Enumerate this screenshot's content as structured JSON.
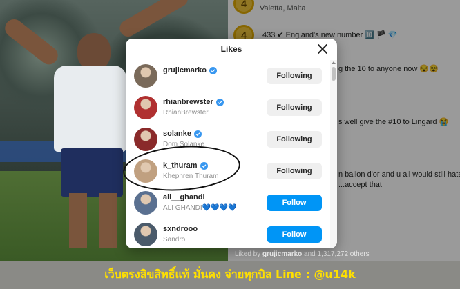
{
  "modal": {
    "title": "Likes",
    "close_label": "✕",
    "items": [
      {
        "username": "grujicmarko",
        "fullname": "",
        "verified": true,
        "button": "Following",
        "following": true,
        "avatar_color": "#7a6a5a"
      },
      {
        "username": "rhianbrewster",
        "fullname": "RhianBrewster",
        "verified": true,
        "button": "Following",
        "following": true,
        "avatar_color": "#b03030"
      },
      {
        "username": "solanke",
        "fullname": "Dom Solanke",
        "verified": true,
        "button": "Following",
        "following": true,
        "avatar_color": "#8a2a2a"
      },
      {
        "username": "k_thuram",
        "fullname": "Khephren Thuram",
        "verified": true,
        "button": "Following",
        "following": true,
        "avatar_color": "#c0a080"
      },
      {
        "username": "ali__ghandi",
        "fullname": "ALI GHANDI💙💙💙💙",
        "verified": false,
        "button": "Follow",
        "following": false,
        "avatar_color": "#5a7090"
      },
      {
        "username": "sxndrooo_",
        "fullname": "Sandro",
        "verified": false,
        "button": "Follow",
        "following": false,
        "avatar_color": "#4a5a6a"
      }
    ]
  },
  "post": {
    "location": "Valetta, Malta",
    "badge1": "4",
    "badge2": "4",
    "comment1": "433 ✔ England's new number 🔟 🏴 💎",
    "comment2": "g the 10 to anyone now 😵😵",
    "comment3": "s well give the #10 to Lingard 😭",
    "comment4a": "n ballon d'or and u all would still hate",
    "comment4b": "...accept that",
    "liked_by_prefix": "Liked by ",
    "liked_by_user": "grujicmarko",
    "liked_by_suffix": " and 1,317,272 others"
  },
  "banner": {
    "text": "เว็บตรงลิขสิทธิ์แท้ มั่นคง จ่ายทุกบิล Line : @u14k"
  },
  "colors": {
    "follow_blue": "#0095f6",
    "verified_blue": "#3897f0",
    "banner_yellow": "#ffe000"
  }
}
